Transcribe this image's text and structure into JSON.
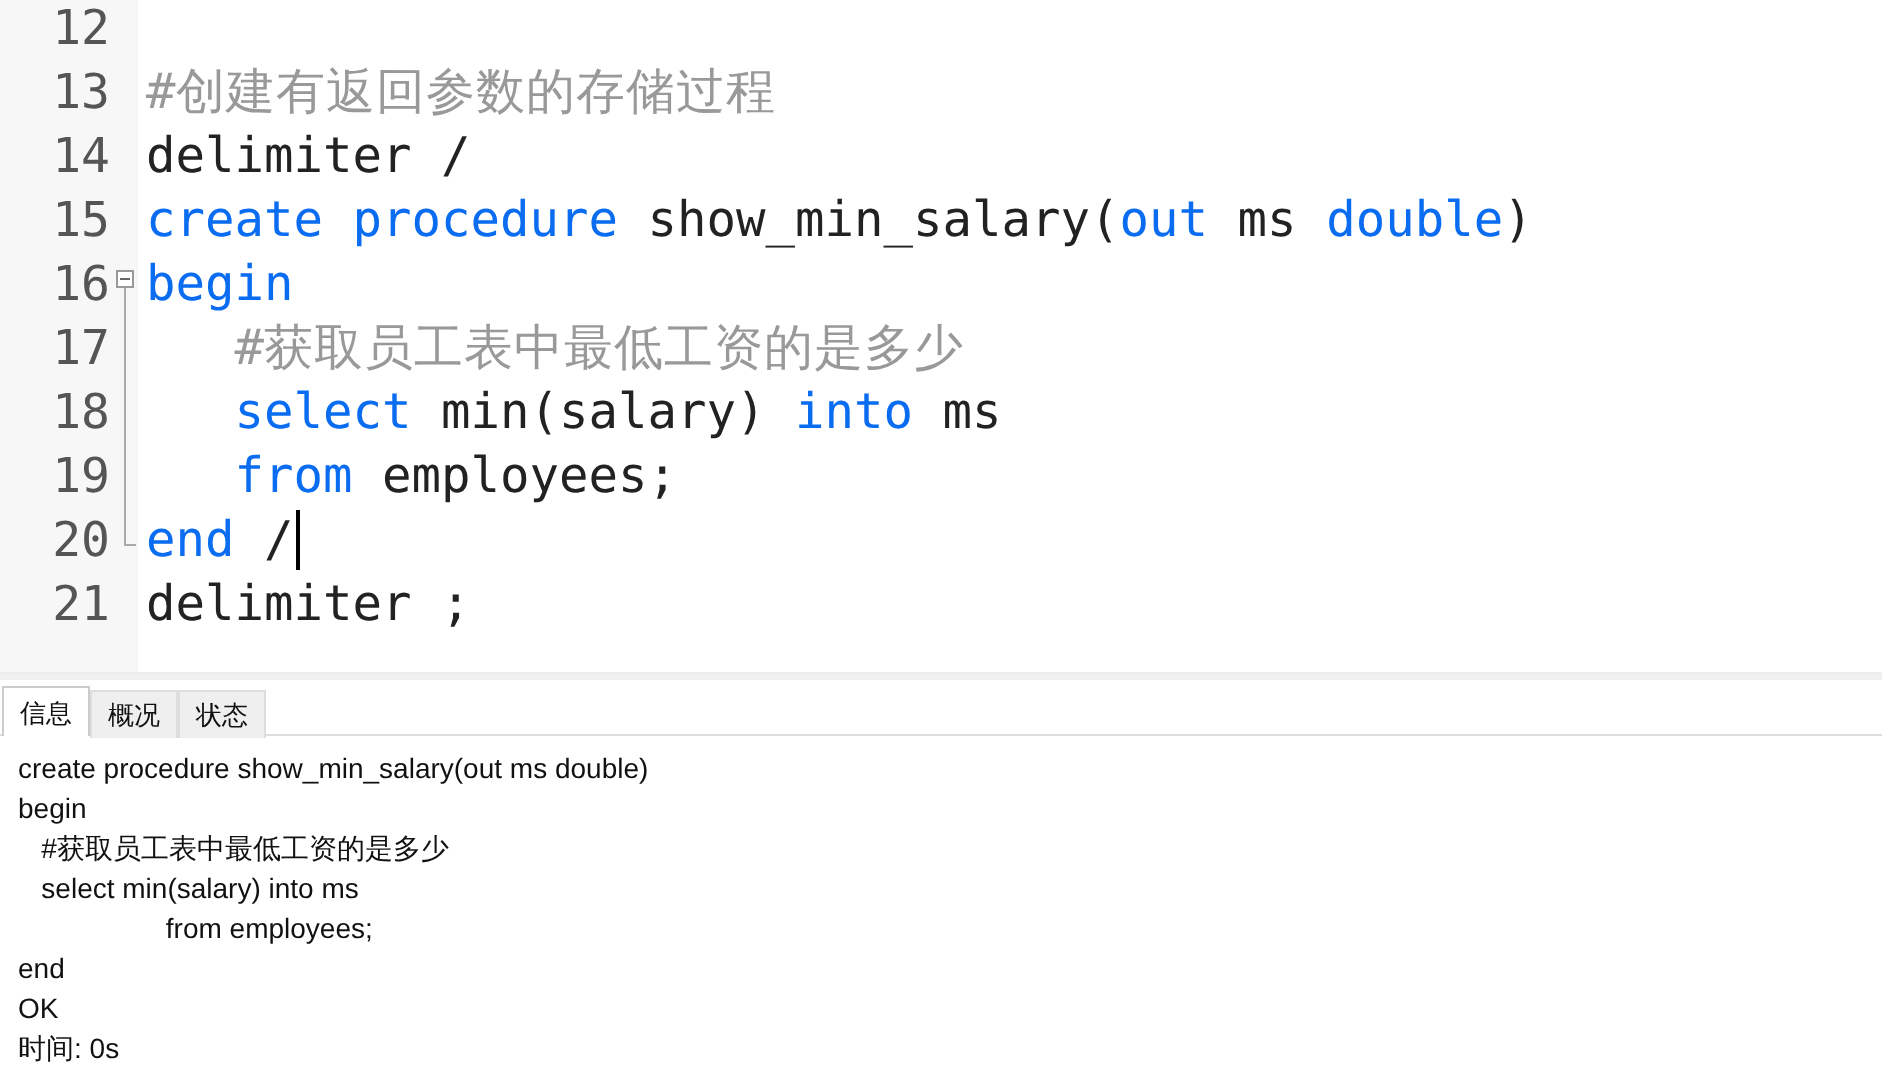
{
  "editor": {
    "lines": [
      {
        "number": "12",
        "kind": "plain"
      },
      {
        "number": "13",
        "kind": "plain",
        "tokens": [
          {
            "kind": "comment",
            "text": "#创建有返回参数的存储过程"
          }
        ]
      },
      {
        "number": "14",
        "kind": "plain",
        "tokens": [
          {
            "kind": "plain",
            "text": "delimiter /"
          }
        ]
      },
      {
        "number": "15",
        "kind": "plain",
        "tokens": [
          {
            "kind": "keyword",
            "text": "create procedure"
          },
          {
            "kind": "plain",
            "text": " show_min_salary("
          },
          {
            "kind": "keyword",
            "text": "out"
          },
          {
            "kind": "plain",
            "text": " ms "
          },
          {
            "kind": "keyword",
            "text": "double"
          },
          {
            "kind": "plain",
            "text": ")"
          }
        ]
      },
      {
        "number": "16",
        "kind": "fold_start",
        "tokens": [
          {
            "kind": "keyword",
            "text": "begin"
          }
        ]
      },
      {
        "number": "17",
        "kind": "fold_body",
        "tokens": [
          {
            "kind": "comment",
            "text": "   #获取员工表中最低工资的是多少"
          }
        ]
      },
      {
        "number": "18",
        "kind": "fold_body",
        "tokens": [
          {
            "kind": "keyword",
            "text": "   select"
          },
          {
            "kind": "plain",
            "text": " min(salary) "
          },
          {
            "kind": "keyword",
            "text": "into"
          },
          {
            "kind": "plain",
            "text": " ms"
          }
        ]
      },
      {
        "number": "19",
        "kind": "fold_body",
        "tokens": [
          {
            "kind": "keyword",
            "text": "   from"
          },
          {
            "kind": "plain",
            "text": " employees;"
          }
        ]
      },
      {
        "number": "20",
        "kind": "fold_end",
        "caret": true,
        "tokens": [
          {
            "kind": "keyword",
            "text": "end"
          },
          {
            "kind": "plain",
            "text": " /"
          }
        ]
      },
      {
        "number": "21",
        "kind": "plain",
        "tokens": [
          {
            "kind": "plain",
            "text": "delimiter ;"
          }
        ]
      }
    ]
  },
  "tabs": [
    {
      "label": "信息",
      "selected": true
    },
    {
      "label": "概况",
      "selected": false
    },
    {
      "label": "状态",
      "selected": false
    }
  ],
  "output": {
    "lines": [
      "create procedure show_min_salary(out ms double)",
      "begin",
      "   #获取员工表中最低工资的是多少",
      "   select min(salary) into ms",
      "                   from employees;",
      "end",
      "OK",
      "时间: 0s"
    ]
  }
}
